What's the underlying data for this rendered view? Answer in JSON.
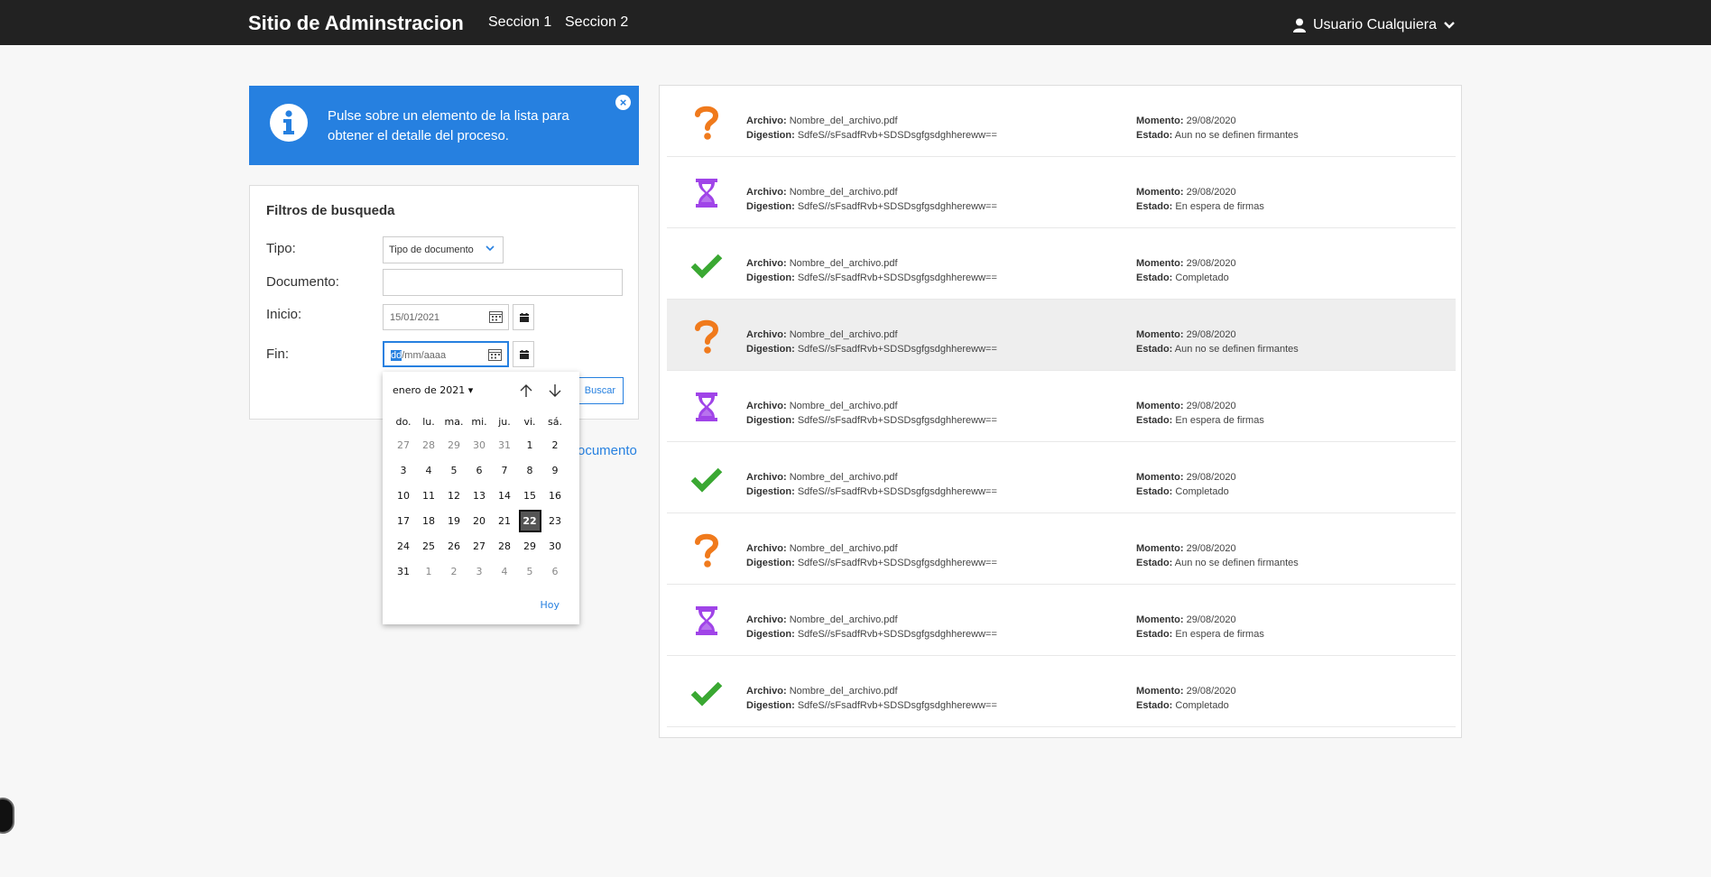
{
  "navbar": {
    "brand": "Sitio de Adminstracion",
    "links": [
      "Seccion 1",
      "Seccion 2"
    ],
    "user": "Usuario Cualquiera"
  },
  "alert": {
    "text": "Pulse sobre un elemento de la lista para obtener el detalle del proceso.",
    "close": "×"
  },
  "filters": {
    "title": "Filtros de busqueda",
    "tipo_label": "Tipo:",
    "tipo_value": "Tipo de documento",
    "documento_label": "Documento:",
    "inicio_label": "Inicio:",
    "inicio_value": "15/01/2021",
    "fin_label": "Fin:",
    "fin_day": "dd",
    "fin_rest": "/mm/aaaa",
    "buscar": "Buscar",
    "link_fragment": "ocumento"
  },
  "datepicker": {
    "month": "enero de 2021",
    "weekdays": [
      "do.",
      "lu.",
      "ma.",
      "mi.",
      "ju.",
      "vi.",
      "sá."
    ],
    "weeks": [
      [
        "27",
        "28",
        "29",
        "30",
        "31",
        "1",
        "2"
      ],
      [
        "3",
        "4",
        "5",
        "6",
        "7",
        "8",
        "9"
      ],
      [
        "10",
        "11",
        "12",
        "13",
        "14",
        "15",
        "16"
      ],
      [
        "17",
        "18",
        "19",
        "20",
        "21",
        "22",
        "23"
      ],
      [
        "24",
        "25",
        "26",
        "27",
        "28",
        "29",
        "30"
      ],
      [
        "31",
        "1",
        "2",
        "3",
        "4",
        "5",
        "6"
      ]
    ],
    "today": "22",
    "hoy": "Hoy"
  },
  "labels": {
    "archivo": "Archivo:",
    "digestion": "Digestion:",
    "momento": "Momento:",
    "estado": "Estado:"
  },
  "colors": {
    "question": "#f07a1c",
    "hourglass": "#a044e8",
    "check": "#3aa832",
    "accent": "#2680e0"
  },
  "documents": [
    {
      "icon": "question-icon",
      "archivo": "Nombre_del_archivo.pdf",
      "digestion": "SdfeS//sFsadfRvb+SDSDsgfgsdghhereww==",
      "momento": "29/08/2020",
      "estado": "Aun no se definen firmantes"
    },
    {
      "icon": "hourglass-icon",
      "archivo": "Nombre_del_archivo.pdf",
      "digestion": "SdfeS//sFsadfRvb+SDSDsgfgsdghhereww==",
      "momento": "29/08/2020",
      "estado": "En espera de firmas"
    },
    {
      "icon": "check-icon",
      "archivo": "Nombre_del_archivo.pdf",
      "digestion": "SdfeS//sFsadfRvb+SDSDsgfgsdghhereww==",
      "momento": "29/08/2020",
      "estado": "Completado"
    },
    {
      "icon": "question-icon",
      "archivo": "Nombre_del_archivo.pdf",
      "digestion": "SdfeS//sFsadfRvb+SDSDsgfgsdghhereww==",
      "momento": "29/08/2020",
      "estado": "Aun no se definen firmantes"
    },
    {
      "icon": "hourglass-icon",
      "archivo": "Nombre_del_archivo.pdf",
      "digestion": "SdfeS//sFsadfRvb+SDSDsgfgsdghhereww==",
      "momento": "29/08/2020",
      "estado": "En espera de firmas"
    },
    {
      "icon": "check-icon",
      "archivo": "Nombre_del_archivo.pdf",
      "digestion": "SdfeS//sFsadfRvb+SDSDsgfgsdghhereww==",
      "momento": "29/08/2020",
      "estado": "Completado"
    },
    {
      "icon": "question-icon",
      "archivo": "Nombre_del_archivo.pdf",
      "digestion": "SdfeS//sFsadfRvb+SDSDsgfgsdghhereww==",
      "momento": "29/08/2020",
      "estado": "Aun no se definen firmantes"
    },
    {
      "icon": "hourglass-icon",
      "archivo": "Nombre_del_archivo.pdf",
      "digestion": "SdfeS//sFsadfRvb+SDSDsgfgsdghhereww==",
      "momento": "29/08/2020",
      "estado": "En espera de firmas"
    },
    {
      "icon": "check-icon",
      "archivo": "Nombre_del_archivo.pdf",
      "digestion": "SdfeS//sFsadfRvb+SDSDsgfgsdghhereww==",
      "momento": "29/08/2020",
      "estado": "Completado"
    }
  ]
}
